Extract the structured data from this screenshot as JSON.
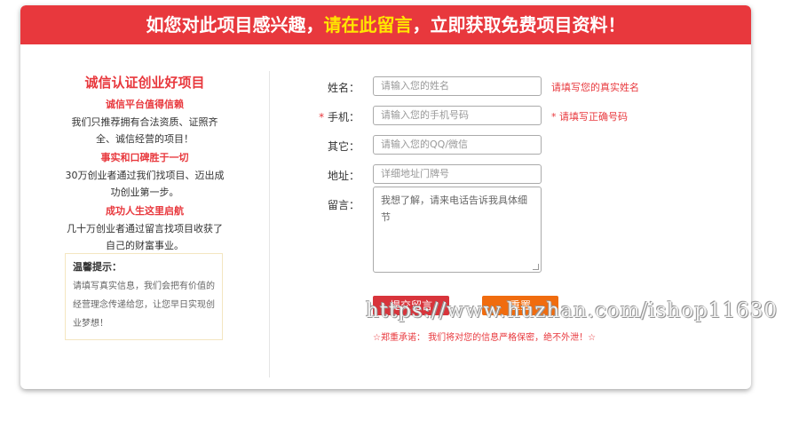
{
  "banner": {
    "part1": "如您对此项目感兴趣，",
    "highlight": "请在此留言",
    "part2": "，立即获取免费项目资料！"
  },
  "left": {
    "title": "诚信认证创业好项目",
    "sections": [
      {
        "heading": "诚信平台值得信赖",
        "text": "我们只推荐拥有合法资质、证照齐全、诚信经营的项目！"
      },
      {
        "heading": "事实和口碑胜于一切",
        "text": "30万创业者通过我们找项目、迈出成功创业第一步。"
      },
      {
        "heading": "成功人生这里启航",
        "text": "几十万创业者通过留言找项目收获了自己的财富事业。"
      }
    ]
  },
  "tips": {
    "title": "温馨提示：",
    "text": "请填写真实信息，我们会把有价值的经营理念传递给您，让您早日实现创业梦想！"
  },
  "form": {
    "name_label": "姓名：",
    "name_placeholder": "请输入您的姓名",
    "name_hint": "请填写您的真实姓名",
    "phone_req": "* ",
    "phone_label": "手机：",
    "phone_placeholder": "请输入您的手机号码",
    "phone_hint": "* 请填写正确号码",
    "other_label": "其它：",
    "other_placeholder": "请输入您的QQ/微信",
    "address_label": "地址：",
    "address_placeholder": "详细地址门牌号",
    "message_label": "留言：",
    "message_value": "我想了解，请来电话告诉我具体细节",
    "submit_label": "提交留言",
    "reset_label": "重置",
    "promise": "☆郑重承诺：  我们将对您的信息严格保密，绝不外泄！☆"
  },
  "watermark": "https://www.huzhan.com/ishop11630"
}
